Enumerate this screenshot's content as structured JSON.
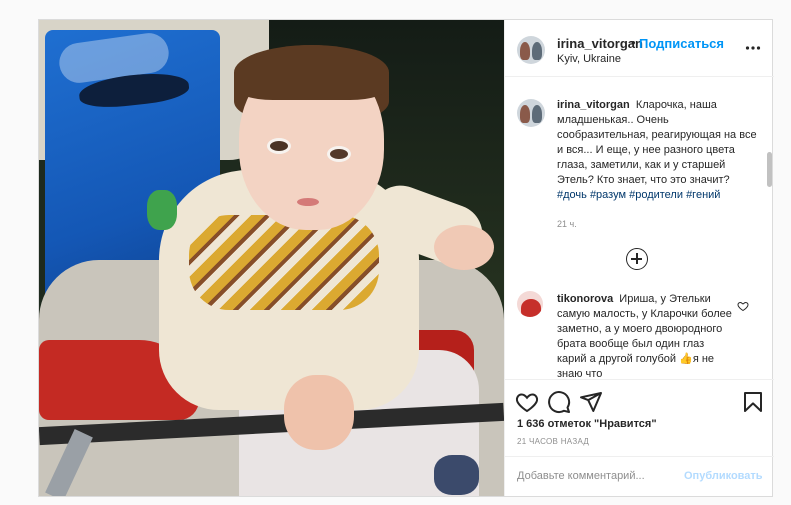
{
  "post": {
    "header": {
      "username": "irina_vitorgan",
      "separator": "•",
      "follow_label": "Подписаться",
      "location": "Kyiv, Ukraine",
      "more_label": "..."
    },
    "caption": {
      "username": "irina_vitorgan",
      "text": "Кларочка, наша младшенькая.. Очень сообразительная, реагирующая на все и вся... И еще, у нее разного цвета глаза, заметили, как и у старшей Этель? Кто знает, что это значит?",
      "hashtags": [
        "#дочь",
        "#разум",
        "#родители",
        "#гений"
      ],
      "time": "21 ч."
    },
    "comments": [
      {
        "username": "tikonorova",
        "text": "Ириша, у Этельки самую малость, у Кларочки более заметно, а у моего двоюродного брата вообще был один глаз карий а другой голубой 👍я не знаю что"
      }
    ],
    "likes_label": "1 636 отметок \"Нравится\"",
    "time_ago": "21 ЧАСОВ НАЗАД",
    "add_comment": {
      "placeholder": "Добавьте комментарий...",
      "publish_label": "Опубликовать"
    },
    "icons": {
      "like": "heart-icon",
      "comment": "comment-icon",
      "share": "paper-plane-icon",
      "save": "bookmark-icon",
      "more": "more-options-icon",
      "load_more": "plus-circle-icon"
    },
    "colors": {
      "accent": "#0095f6",
      "hashtag": "#00376b",
      "muted": "#8e8e8e",
      "publish_disabled": "#b3dbff"
    }
  }
}
